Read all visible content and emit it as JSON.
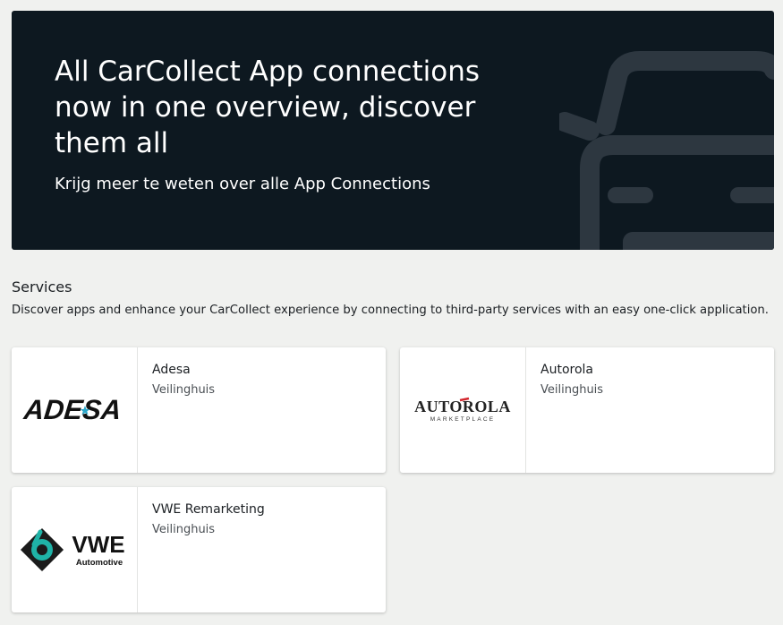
{
  "hero": {
    "title": "All CarCollect App connections now in one overview, discover them all",
    "subtitle": "Krijg meer te weten over alle App Connections",
    "background_color": "#0d1820",
    "icon": "car-icon"
  },
  "services": {
    "title": "Services",
    "description": "Discover apps and enhance your CarCollect experience by connecting to third-party services with an easy one-click application.",
    "cards": [
      {
        "name": "Adesa",
        "category": "Veilinghuis",
        "logo_text": "ADESA"
      },
      {
        "name": "Autorola",
        "category": "Veilinghuis",
        "logo_text": "AUTOROLA",
        "logo_subtext": "MARKETPLACE"
      },
      {
        "name": "VWE Remarketing",
        "category": "Veilinghuis",
        "logo_text": "VWE",
        "logo_subtext": "Automotive"
      }
    ]
  }
}
